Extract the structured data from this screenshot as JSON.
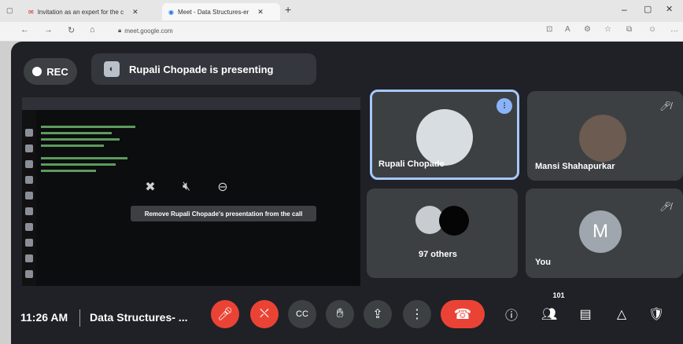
{
  "browser": {
    "tabs": [
      {
        "title": "Invitation as an expert for the c"
      },
      {
        "title": "Meet - Data Structures-er"
      }
    ],
    "url": "meet.google.com"
  },
  "meet": {
    "rec_label": "REC",
    "presenting_text": "Rupali Chopade is presenting",
    "presentation_tooltip": "Remove Rupali Chopade's presentation from the call",
    "tiles": [
      {
        "name": "Rupali Chopade"
      },
      {
        "name": "Mansi Shahapurkar"
      },
      {
        "name": "97 others"
      },
      {
        "name": "You",
        "initial": "M"
      }
    ],
    "time": "11:26 AM",
    "meeting_title": "Data Structures- ...",
    "participants_count": "101"
  },
  "colors": {
    "stage_bg": "#1f2126",
    "tile_bg": "#3c4043",
    "end_call": "#ea4335",
    "active_speaker_border": "#a8c7fa",
    "you_avatar": "#a0a6ad"
  },
  "icons": [
    "mic-off-icon",
    "camera-off-icon",
    "captions-icon",
    "raise-hand-icon",
    "present-icon",
    "more-options-icon",
    "end-call-icon",
    "info-icon",
    "people-icon",
    "chat-icon",
    "activities-icon",
    "host-controls-icon"
  ]
}
